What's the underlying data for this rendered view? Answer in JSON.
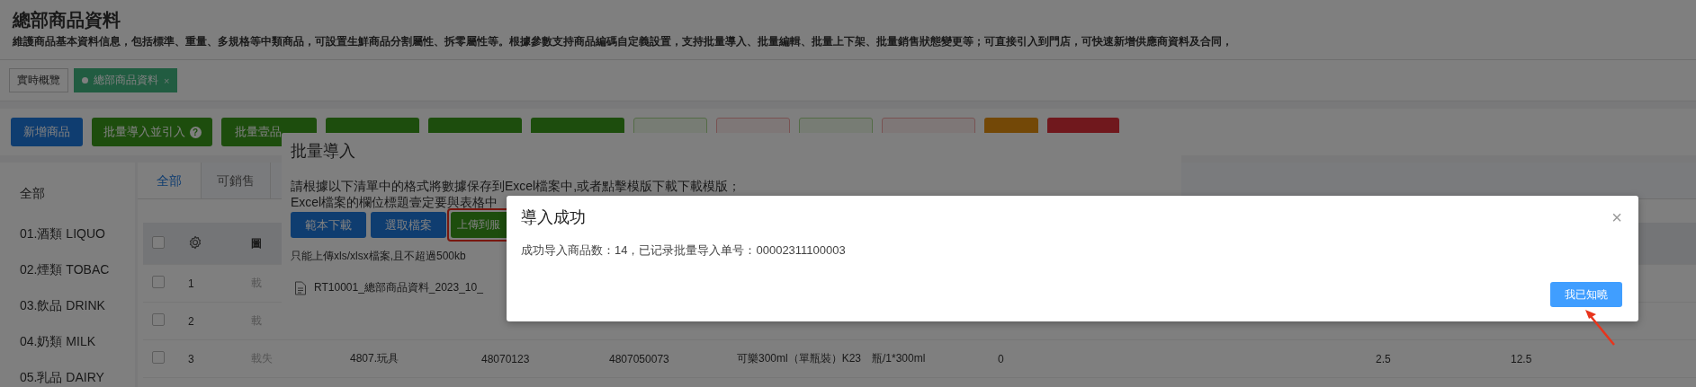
{
  "page": {
    "title": "總部商品資料",
    "description": "維護商品基本資料信息，包括標準、重量、多規格等中類商品，可設置生鮮商品分割屬性、拆零屬性等。根據參數支持商品編碼自定義設置，支持批量導入、批量編輯、批量上下架、批量銷售狀態變更等；可直接引入到門店，可快速新增供應商資料及合同，"
  },
  "page_tabs": [
    {
      "label": "實時概覽",
      "selected": false
    },
    {
      "label": "總部商品資料",
      "selected": true,
      "close_mark": "×"
    }
  ],
  "toolbar": [
    {
      "label": "新增商品",
      "kind": "primary"
    },
    {
      "label": "批量導入並引入",
      "kind": "success",
      "help_mark": "?"
    },
    {
      "label": "批量壹品",
      "kind": "success"
    },
    {
      "kind": "success"
    },
    {
      "kind": "success"
    },
    {
      "kind": "success"
    },
    {
      "kind": "success-plain"
    },
    {
      "kind": "danger-plain"
    },
    {
      "kind": "success-plain"
    },
    {
      "kind": "danger-plain"
    },
    {
      "kind": "warning"
    },
    {
      "kind": "danger"
    }
  ],
  "sidebar": {
    "items": [
      "全部",
      "01.酒類 LIQUO",
      "02.煙類 TOBAC",
      "03.飲品 DRINK",
      "04.奶類 MILK",
      "05.乳品 DAIRY"
    ]
  },
  "content_tabs": [
    {
      "label": "全部",
      "selected": true
    },
    {
      "label": "可銷售",
      "selected": false
    }
  ],
  "table": {
    "header": {
      "checked": false,
      "column_3": "圖"
    },
    "rows": [
      {
        "checked": false,
        "cells": [
          "1",
          "載"
        ]
      },
      {
        "checked": false,
        "cells": [
          "2",
          "載"
        ]
      },
      {
        "checked": false,
        "cells": [
          "3",
          "載失",
          "4807.玩具",
          "48070123",
          "4807050073",
          "可樂300ml（單瓶裝）K23",
          "瓶/1*300ml",
          "0",
          "2.5",
          "12.5"
        ]
      }
    ]
  },
  "import_dialog": {
    "title": "批量導入",
    "instructions": [
      "請根據以下清單中的格式將數據保存到Excel檔案中,或者點擊模版下載下載模版；",
      "Excel檔案的欄位標題壹定要與表格中"
    ],
    "buttons": [
      {
        "label": "範本下載",
        "kind": "primary",
        "highlighted": false
      },
      {
        "label": "選取檔案",
        "kind": "primary",
        "highlighted": false
      },
      {
        "label": "上傳到服",
        "kind": "success",
        "highlighted": true
      }
    ],
    "note": "只能上傳xls/xlsx檔案,且不超過500kb",
    "file": "RT10001_總部商品資料_2023_10_"
  },
  "success_dialog": {
    "title": "導入成功",
    "close": "×",
    "message": "成功导入商品数：14，已记录批量导入单号：00002311100003",
    "button": "我已知曉"
  }
}
